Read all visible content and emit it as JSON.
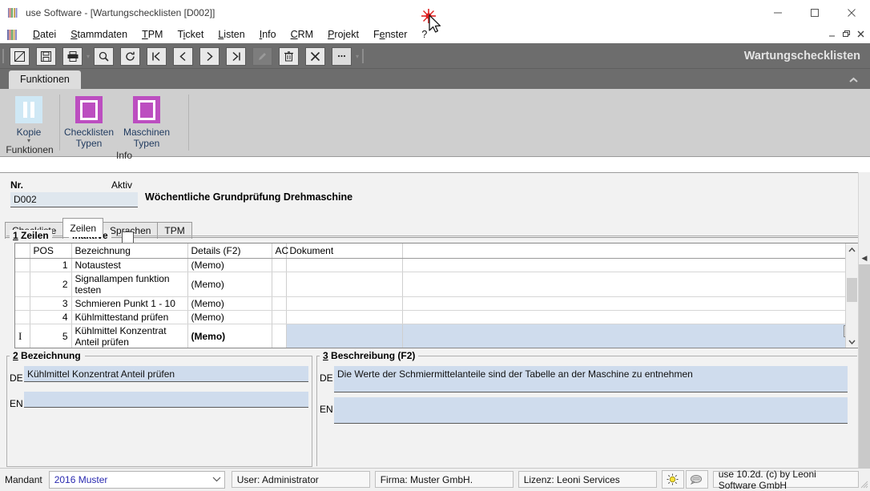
{
  "window": {
    "title": "use Software - [Wartungschecklisten [D002]]",
    "app_icon": "app-grid-icon",
    "minimize": "–",
    "maximize": "□",
    "close": "✕"
  },
  "menubar": {
    "items": [
      {
        "label": "Datei",
        "accel": "D"
      },
      {
        "label": "Stammdaten",
        "accel": "S"
      },
      {
        "label": "TPM",
        "accel": "T"
      },
      {
        "label": "Ticket",
        "accel": "i"
      },
      {
        "label": "Listen",
        "accel": "L"
      },
      {
        "label": "Info",
        "accel": "I"
      },
      {
        "label": "CRM",
        "accel": "C"
      },
      {
        "label": "Projekt",
        "accel": "P"
      },
      {
        "label": "Fenster",
        "accel": "e"
      },
      {
        "label": "?",
        "accel": ""
      }
    ],
    "mdi_controls": [
      "–",
      "❐",
      "✕"
    ]
  },
  "toolbar": {
    "document_title": "Wartungschecklisten",
    "buttons": [
      {
        "name": "new-record-button",
        "glyph": "▨"
      },
      {
        "name": "save-button",
        "glyph": "💾"
      },
      {
        "name": "print-button",
        "glyph": "🖶"
      },
      {
        "name": "search-button",
        "glyph": "🔍"
      },
      {
        "name": "refresh-button",
        "glyph": "↺"
      },
      {
        "name": "first-record-button",
        "glyph": "|◀"
      },
      {
        "name": "previous-record-button",
        "glyph": "◀"
      },
      {
        "name": "next-record-button",
        "glyph": "▶"
      },
      {
        "name": "last-record-button",
        "glyph": "▶|"
      },
      {
        "name": "edit-button",
        "glyph": "✎"
      },
      {
        "name": "delete-button",
        "glyph": "🗑"
      },
      {
        "name": "cancel-button",
        "glyph": "✕"
      },
      {
        "name": "more-options-button",
        "glyph": "…"
      }
    ]
  },
  "ribbon": {
    "tab": "Funktionen",
    "collapse_icon": "chevron-up-icon",
    "groups": [
      {
        "label": "Funktionen",
        "buttons": [
          {
            "name": "kopie-button",
            "label_line1": "Kopie",
            "label_line2": "",
            "icon": "pause-icon",
            "has_dropdown": true
          }
        ]
      },
      {
        "label": "Info",
        "buttons": [
          {
            "name": "checklisten-typen-button",
            "label_line1": "Checklisten",
            "label_line2": "Typen",
            "icon": "square-outline-icon",
            "has_dropdown": false
          },
          {
            "name": "maschinen-typen-button",
            "label_line1": "Maschinen",
            "label_line2": "Typen",
            "icon": "square-outline-icon",
            "has_dropdown": false
          }
        ]
      }
    ]
  },
  "header": {
    "nr_label": "Nr.",
    "nr_value": "D002",
    "aktiv_label": "Aktiv",
    "aktiv_value": "",
    "record_title": "Wöchentliche Grundprüfung Drehmaschine"
  },
  "tabs": [
    {
      "label": "Checkliste",
      "active": false
    },
    {
      "label": "Zeilen",
      "active": true
    },
    {
      "label": "Sprachen",
      "active": false
    },
    {
      "label": "TPM",
      "active": false
    }
  ],
  "zeilen_section": {
    "number": "1",
    "legend": "Zeilen",
    "inaktive_label": "inaktive",
    "inaktive_checked": false,
    "columns": [
      "POS",
      "Bezeichnung",
      "Details (F2)",
      "AC",
      "Dokument",
      ""
    ],
    "rows": [
      {
        "indicator": "",
        "pos": "1",
        "bezeichnung": "Notaustest",
        "details": "(Memo)",
        "ac": "",
        "dokument": "",
        "selected": false
      },
      {
        "indicator": "",
        "pos": "2",
        "bezeichnung": "Signallampen funktion testen",
        "details": "(Memo)",
        "ac": "",
        "dokument": "",
        "selected": false
      },
      {
        "indicator": "",
        "pos": "3",
        "bezeichnung": "Schmieren Punkt 1 - 10",
        "details": "(Memo)",
        "ac": "",
        "dokument": "",
        "selected": false
      },
      {
        "indicator": "",
        "pos": "4",
        "bezeichnung": "Kühlmittestand prüfen",
        "details": "(Memo)",
        "ac": "",
        "dokument": "",
        "selected": false
      },
      {
        "indicator": "I",
        "pos": "5",
        "bezeichnung": "Kühlmittel Konzentrat Anteil prüfen",
        "details": "(Memo)",
        "ac": "",
        "dokument": "",
        "selected": true
      }
    ],
    "ellipsis_button": "…",
    "scroll_up": "⌃",
    "scroll_down": "⌄"
  },
  "bezeichnung_section": {
    "number": "2",
    "legend": "Bezeichnung",
    "de_label": "DE",
    "de_value": "Kühlmittel Konzentrat Anteil prüfen",
    "en_label": "EN",
    "en_value": ""
  },
  "beschreibung_section": {
    "number": "3",
    "legend": "Beschreibung (F2)",
    "de_label": "DE",
    "de_value": "Die Werte der Schmiermittelanteile sind der Tabelle an der Maschine zu entnehmen",
    "en_label": "EN",
    "en_value": ""
  },
  "statusbar": {
    "mandant_label": "Mandant",
    "mandant_value": "2016 Muster",
    "user": "User: Administrator",
    "firma": "Firma: Muster GmbH.",
    "lizenz": "Lizenz: Leoni Services",
    "icon_hint": "lightbulb-icon",
    "icon_chat": "chat-bubble-icon",
    "version": "use 10.2d. (c) by Leoni Software GmbH"
  },
  "colors": {
    "field_bg": "#dfe7ee",
    "selected_bg": "#cfdced",
    "ribbon_bg": "#cfcfcf",
    "toolbar_bg": "#6d6d6d",
    "accent_magenta": "#bc4ec0",
    "accent_lightblue": "#cfe8f5",
    "link_blue": "#2a2ab0"
  }
}
